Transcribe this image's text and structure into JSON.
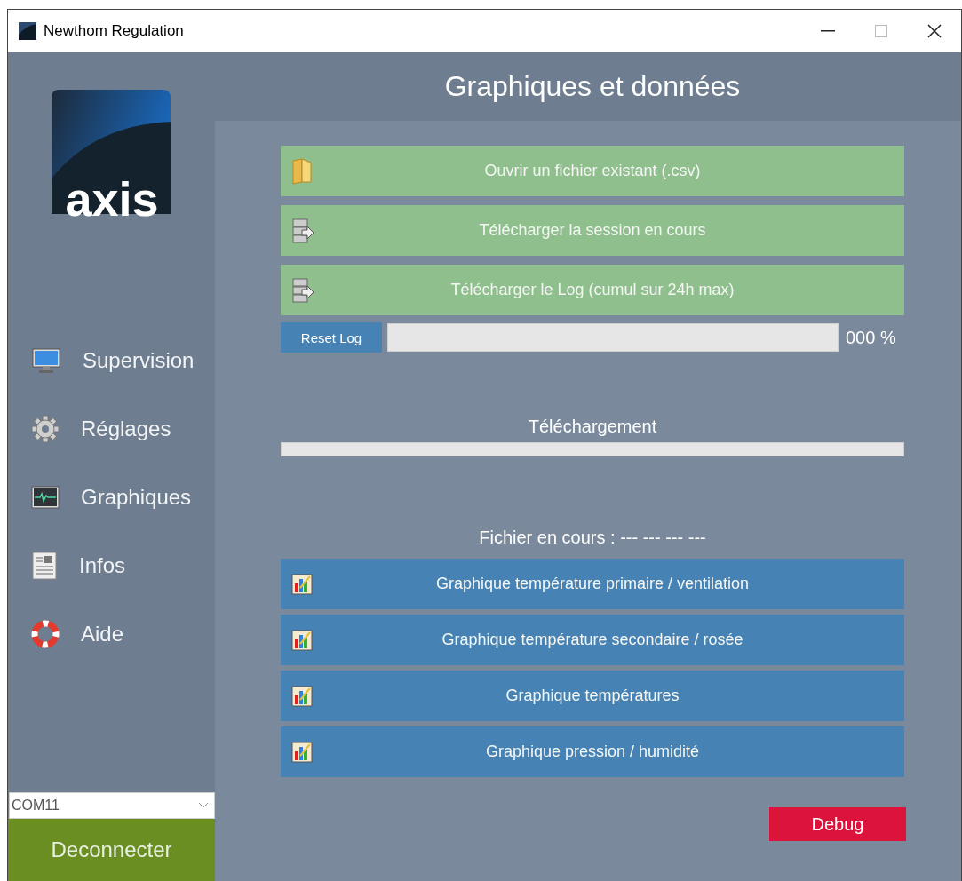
{
  "window": {
    "title": "Newthom Regulation"
  },
  "sidebar": {
    "logo": "axis",
    "items": [
      {
        "label": "Supervision",
        "kind": "monitor"
      },
      {
        "label": "Réglages",
        "kind": "gear"
      },
      {
        "label": "Graphiques",
        "kind": "pulse"
      },
      {
        "label": "Infos",
        "kind": "document"
      },
      {
        "label": "Aide",
        "kind": "lifebuoy"
      }
    ],
    "port_select": {
      "value": "COM11"
    },
    "connect_button": "Deconnecter"
  },
  "header": {
    "title": "Graphiques et données"
  },
  "file_buttons": [
    {
      "label": "Ouvrir un fichier existant (.csv)",
      "kind": "folder"
    },
    {
      "label": "Télécharger la session en cours",
      "kind": "download"
    },
    {
      "label": "Télécharger le Log (cumul sur 24h max)",
      "kind": "download"
    }
  ],
  "log": {
    "reset_button": "Reset Log",
    "level": 0,
    "reading": "000 %"
  },
  "download": {
    "label": "Téléchargement",
    "level": 0
  },
  "current_file": "Fichier en cours : --- --- --- ---",
  "chart_buttons": [
    {
      "label": "Graphique température primaire / ventilation"
    },
    {
      "label": "Graphique température secondaire / rosée"
    },
    {
      "label": "Graphique températures"
    },
    {
      "label": "Graphique pression / humidité"
    }
  ],
  "debug_button": "Debug"
}
